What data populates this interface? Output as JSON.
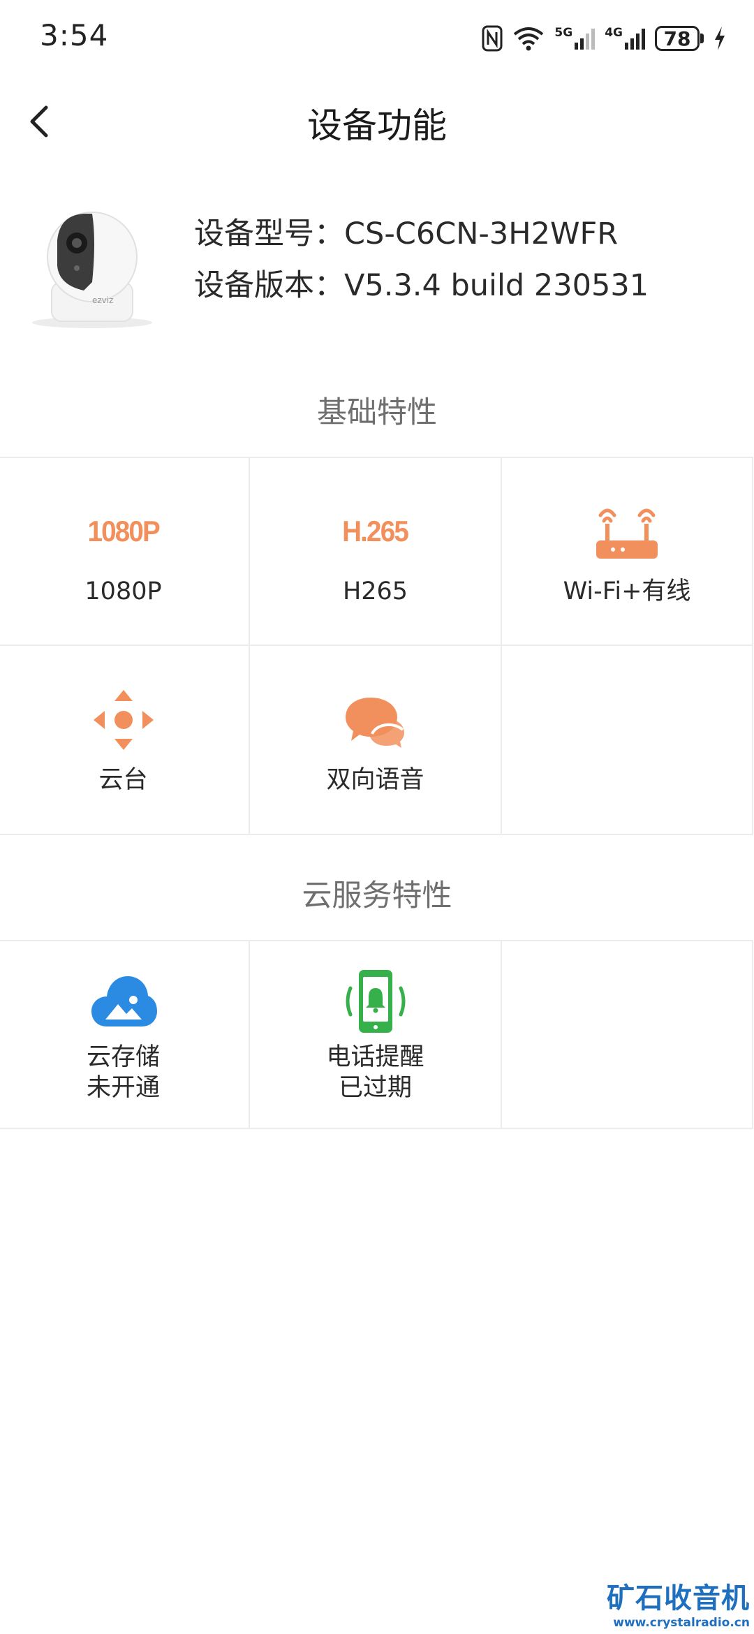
{
  "status_bar": {
    "time": "3:54",
    "battery": "78",
    "net_5g": "5G",
    "net_4g": "4G",
    "icons": [
      "nfc-icon",
      "wifi-icon",
      "signal-5g-icon",
      "signal-4g-icon",
      "battery-icon",
      "charging-icon"
    ]
  },
  "header": {
    "title": "设备功能"
  },
  "device": {
    "model_line": "设备型号：CS-C6CN-3H2WFR",
    "version_line": "设备版本：V5.3.4 build 230531",
    "brand_on_image": "ezviz"
  },
  "basic": {
    "section_title": "基础特性",
    "items": [
      {
        "label": "1080P",
        "badge": "1080P",
        "icon": "resolution-badge"
      },
      {
        "label": "H265",
        "badge": "H.265",
        "icon": "codec-badge"
      },
      {
        "label": "Wi-Fi+有线",
        "icon": "router-icon"
      },
      {
        "label": "云台",
        "icon": "ptz-icon"
      },
      {
        "label": "双向语音",
        "icon": "chat-bubbles-icon"
      }
    ]
  },
  "cloud": {
    "section_title": "云服务特性",
    "items": [
      {
        "label": "云存储",
        "status": "未开通",
        "icon": "cloud-storage-icon"
      },
      {
        "label": "电话提醒",
        "status": "已过期",
        "icon": "phone-alert-icon"
      }
    ]
  },
  "watermark": {
    "title": "矿石收音机",
    "url": "www.crystalradio.cn"
  },
  "colors": {
    "accent_orange": "#f2905d",
    "cloud_blue": "#2b8be3",
    "phone_green": "#36b04a",
    "divider": "#ececec",
    "section_text": "#6f6f6f"
  }
}
